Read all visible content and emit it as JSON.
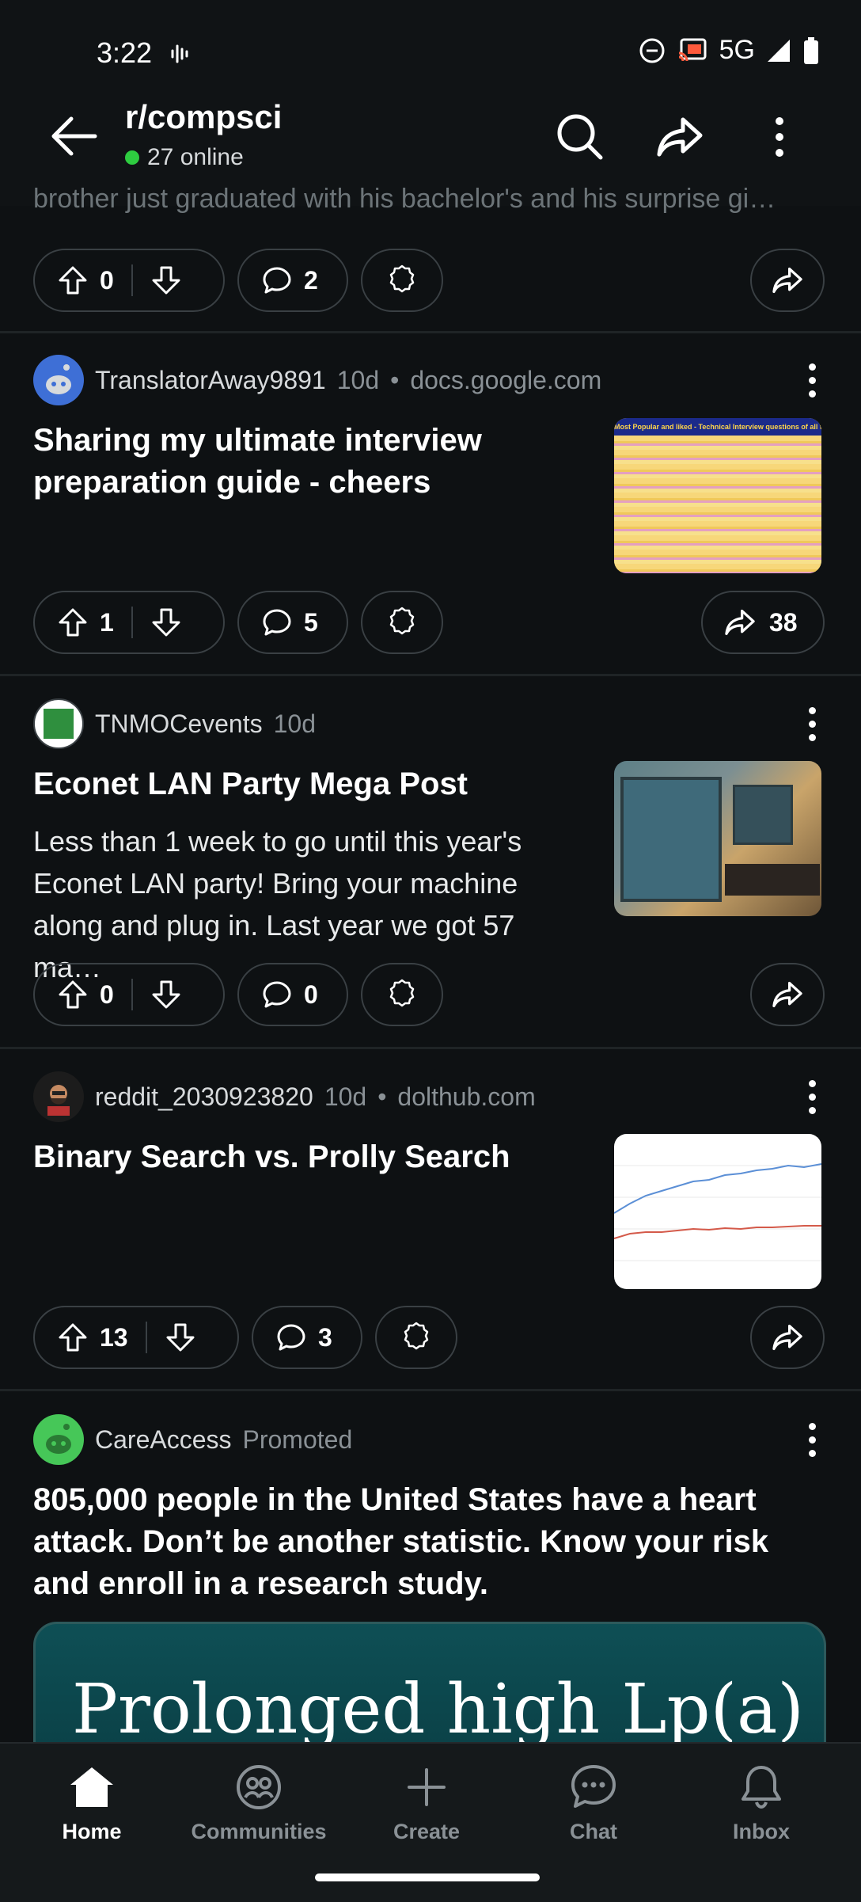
{
  "status_bar": {
    "time": "3:22",
    "network": "5G"
  },
  "header": {
    "subreddit": "r/compsci",
    "online": "27 online"
  },
  "ghost_text": "brother just graduated with his bachelor's and his surprise gi…",
  "first_actions": {
    "votes": "0",
    "comments": "2"
  },
  "posts": [
    {
      "author": "TranslatorAway9891",
      "age": "10d",
      "separator": "•",
      "domain": "docs.google.com",
      "title": "Sharing my ultimate interview preparation guide - cheers",
      "votes": "1",
      "comments": "5",
      "shares": "38",
      "thumb_caption": "Most Popular and liked - Technical Interview questions of all time"
    },
    {
      "author": "TNMOCevents",
      "age": "10d",
      "title": "Econet LAN Party Mega Post",
      "body": "Less than 1 week to go until this year's Econet LAN party! Bring your machine along and plug in. Last year we got 57 ma…",
      "votes": "0",
      "comments": "0"
    },
    {
      "author": "reddit_2030923820",
      "age": "10d",
      "separator": "•",
      "domain": "dolthub.com",
      "title": "Binary Search vs. Prolly Search",
      "votes": "13",
      "comments": "3"
    }
  ],
  "ad": {
    "author": "CareAccess",
    "label": "Promoted",
    "title": "805,000 people in the United States have a heart attack. Don’t be another statistic. Know your risk and enroll in a research study.",
    "card_text": "Prolonged high Lp(a)"
  },
  "nav": {
    "home": "Home",
    "communities": "Communities",
    "create": "Create",
    "chat": "Chat",
    "inbox": "Inbox"
  },
  "colors": {
    "background": "#0e1113",
    "accent_online": "#2ecc40",
    "ad_card": "#0e4f55"
  }
}
